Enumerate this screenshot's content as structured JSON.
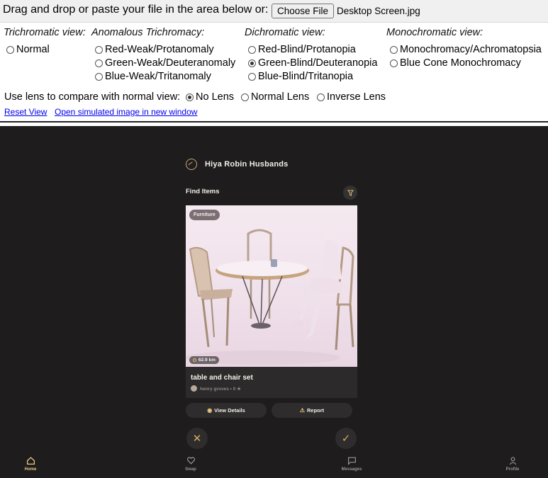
{
  "toolbar": {
    "instruction": "Drag and drop or paste your file in the area below or:",
    "choose_file_label": "Choose File",
    "file_name": "Desktop Screen.jpg"
  },
  "view_groups": [
    {
      "heading": "Trichromatic view:",
      "options": [
        "Normal"
      ]
    },
    {
      "heading": "Anomalous Trichromacy:",
      "options": [
        "Red-Weak/Protanomaly",
        "Green-Weak/Deuteranomaly",
        "Blue-Weak/Tritanomaly"
      ]
    },
    {
      "heading": "Dichromatic view:",
      "options": [
        "Red-Blind/Protanopia",
        "Green-Blind/Deuteranopia",
        "Blue-Blind/Tritanopia"
      ]
    },
    {
      "heading": "Monochromatic view:",
      "options": [
        "Monochromacy/Achromatopsia",
        "Blue Cone Monochromacy"
      ]
    }
  ],
  "selected_view": "Green-Blind/Deuteranopia",
  "lens": {
    "label": "Use lens to compare with normal view:",
    "options": [
      "No Lens",
      "Normal Lens",
      "Inverse Lens"
    ],
    "selected": "No Lens"
  },
  "links": {
    "reset": "Reset View",
    "open_new": "Open simulated image in new window"
  },
  "app": {
    "title": "Hiya Robin Husbands",
    "section_title": "Find Items",
    "card": {
      "category": "Furniture",
      "distance": "62.9 km",
      "title": "table and chair set",
      "meta": "henry groves • 0 ★"
    },
    "actions": {
      "view_details": "View Details",
      "report": "Report"
    },
    "nav": [
      {
        "label": "Home",
        "icon": "home-icon",
        "active": true
      },
      {
        "label": "Swap",
        "icon": "heart-icon",
        "active": false
      },
      {
        "label": "Messages",
        "icon": "message-icon",
        "active": false
      },
      {
        "label": "Profile",
        "icon": "user-icon",
        "active": false
      }
    ]
  },
  "colors": {
    "accent": "#e9c982",
    "screen_bg": "#1e1c1c",
    "card_bg": "#2c2a2a"
  }
}
